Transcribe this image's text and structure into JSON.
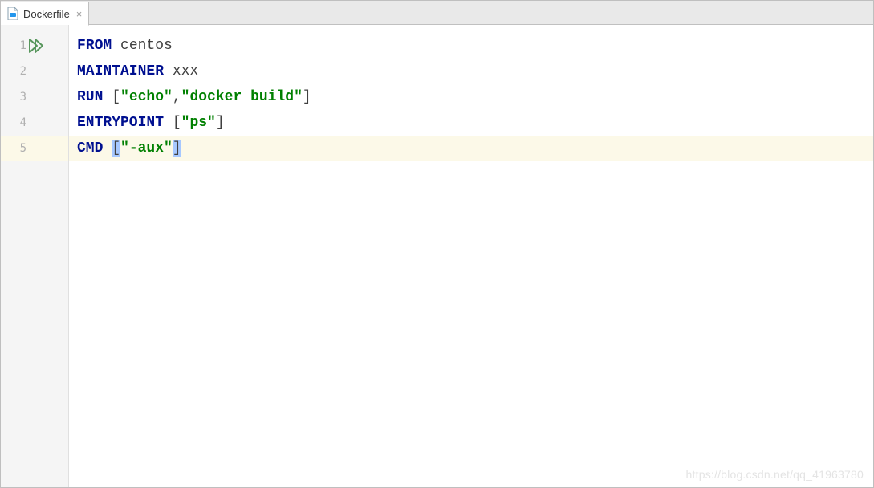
{
  "tab": {
    "filename": "Dockerfile",
    "close_glyph": "×"
  },
  "gutter": {
    "line_numbers": [
      "1",
      "2",
      "3",
      "4",
      "5"
    ]
  },
  "code": {
    "lines": [
      {
        "kw": "FROM",
        "rest_id": " centos"
      },
      {
        "kw": "MAINTAINER",
        "rest_id": " xxx"
      },
      {
        "kw": "RUN",
        "sp": " ",
        "open": "[",
        "s1": "\"echo\"",
        "comma": ",",
        "s2": "\"docker build\"",
        "close": "]"
      },
      {
        "kw": "ENTRYPOINT",
        "sp": " ",
        "open": "[",
        "s1": "\"ps\"",
        "close": "]"
      },
      {
        "kw": "CMD",
        "sp": " ",
        "open": "[",
        "s1": "\"-aux\"",
        "close": "]"
      }
    ]
  },
  "watermark": "https://blog.csdn.net/qq_41963780"
}
